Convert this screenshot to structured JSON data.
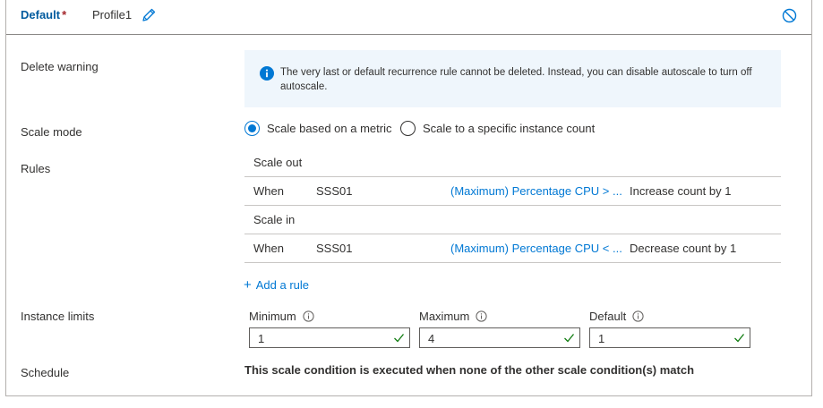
{
  "header": {
    "title": "Default",
    "required_marker": "*",
    "profile_name": "Profile1"
  },
  "labels": {
    "delete_warning": "Delete warning",
    "scale_mode": "Scale mode",
    "rules": "Rules",
    "instance_limits": "Instance limits",
    "schedule": "Schedule"
  },
  "info_message": "The very last or default recurrence rule cannot be deleted. Instead, you can disable autoscale to turn off autoscale.",
  "scale_mode": {
    "options": [
      {
        "label": "Scale based on a metric",
        "selected": true
      },
      {
        "label": "Scale to a specific instance count",
        "selected": false
      }
    ]
  },
  "rules": {
    "scale_out": {
      "heading": "Scale out",
      "row": {
        "when": "When",
        "resource": "SSS01",
        "condition": "(Maximum) Percentage CPU > ...",
        "action": "Increase count by 1"
      }
    },
    "scale_in": {
      "heading": "Scale in",
      "row": {
        "when": "When",
        "resource": "SSS01",
        "condition": "(Maximum) Percentage CPU < ...",
        "action": "Decrease count by 1"
      }
    },
    "add_rule": "Add a rule"
  },
  "instance_limits": {
    "minimum": {
      "label": "Minimum",
      "value": "1"
    },
    "maximum": {
      "label": "Maximum",
      "value": "4"
    },
    "default": {
      "label": "Default",
      "value": "1"
    }
  },
  "schedule_text": "This scale condition is executed when none of the other scale condition(s) match",
  "icons": {
    "edit": "pencil-icon",
    "disable": "prohibited-icon",
    "info": "info-icon",
    "valid": "checkmark-icon"
  },
  "colors": {
    "accent": "#0078d4",
    "title": "#005a9e",
    "required": "#a4262c",
    "info_bg": "#eff6fc",
    "valid": "#107c10"
  }
}
